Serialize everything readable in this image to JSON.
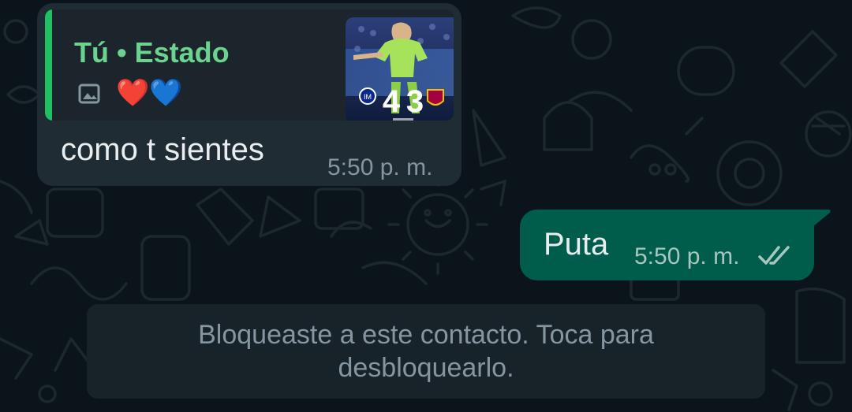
{
  "incoming_message": {
    "quote": {
      "author": "Tú • Estado",
      "emoji": [
        "❤️",
        "💙"
      ],
      "media_icon": "image-icon",
      "thumbnail": {
        "score_home": "4",
        "score_away": "3"
      }
    },
    "text": "como t sientes",
    "time": "5:50 p. m."
  },
  "outgoing_message": {
    "text": "Puta",
    "time": "5:50 p. m.",
    "status_icon": "double-check-icon"
  },
  "blocked_notice": {
    "text": "Bloqueaste a este contacto. Toca para desbloquearlo."
  },
  "colors": {
    "background": "#0b141a",
    "incoming_bubble": "#202c33",
    "outgoing_bubble": "#005c4b",
    "quote_accent": "#21c063",
    "quote_author": "#6bd38f",
    "timestamp": "#8696a0",
    "text": "#e9edef"
  }
}
